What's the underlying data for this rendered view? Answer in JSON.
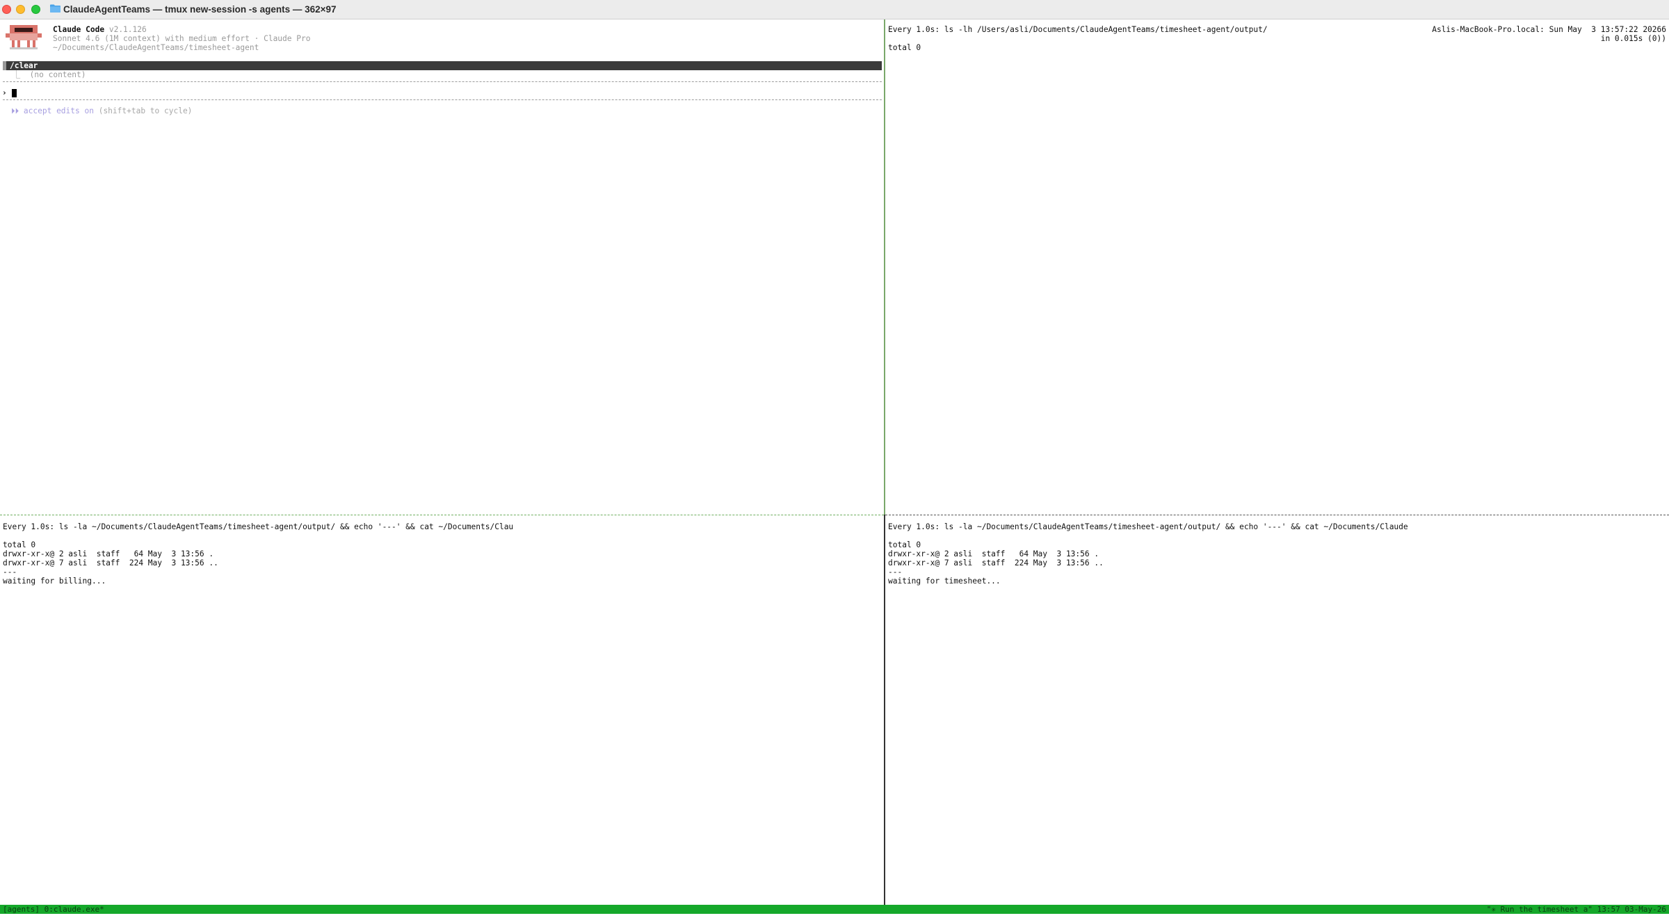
{
  "window": {
    "title": "ClaudeAgentTeams — tmux new-session -s agents — 362×97"
  },
  "claude_pane": {
    "app_name": "Claude Code",
    "version": "v2.1.126",
    "model_line": "Sonnet 4.6 (1M context) with medium effort · Claude Pro",
    "path": "~/Documents/ClaudeAgentTeams/timesheet-agent",
    "command": "/clear",
    "result": "⎿  (no content)",
    "prompt_char": "›",
    "accept_prefix": "⏵⏵ accept edits on",
    "accept_hint": " (shift+tab to cycle)"
  },
  "watch_top_right": {
    "header": "Every 1.0s: ls -lh /Users/asli/Documents/ClaudeAgentTeams/timesheet-agent/output/",
    "host": "Aslis-MacBook-Pro.local: Sun May  3 13:57:22 20266",
    "timing": "in 0.015s (0))",
    "lines": [
      "total 0"
    ]
  },
  "watch_bottom_left": {
    "header": "Every 1.0s: ls -la ~/Documents/ClaudeAgentTeams/timesheet-agent/output/ && echo '---' && cat ~/Documents/Clau",
    "lines": [
      "",
      "total 0",
      "drwxr-xr-x@ 2 asli  staff   64 May  3 13:56 .",
      "drwxr-xr-x@ 7 asli  staff  224 May  3 13:56 ..",
      "---",
      "waiting for billing..."
    ]
  },
  "watch_bottom_right": {
    "header": "Every 1.0s: ls -la ~/Documents/ClaudeAgentTeams/timesheet-agent/output/ && echo '---' && cat ~/Documents/Claude",
    "lines": [
      "",
      "total 0",
      "drwxr-xr-x@ 2 asli  staff   64 May  3 13:56 .",
      "drwxr-xr-x@ 7 asli  staff  224 May  3 13:56 ..",
      "---",
      "waiting for timesheet..."
    ]
  },
  "tmux_status": {
    "left": "[agents] 0:claude.exe*",
    "right": "\"✳ Run the timesheet a\" 13:57 03-May-26",
    "color": "#15a82a"
  }
}
